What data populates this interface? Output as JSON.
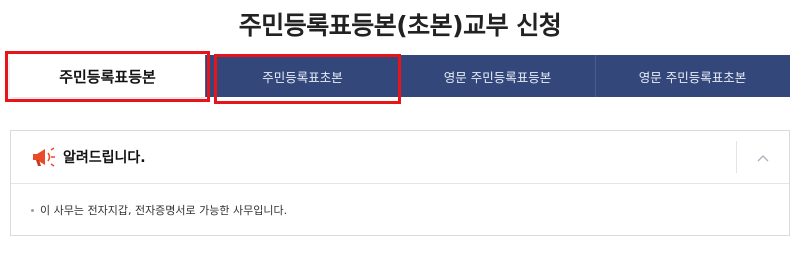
{
  "page": {
    "title": "주민등록표등본(초본)교부 신청"
  },
  "tabs": [
    {
      "label": "주민등록표등본",
      "active": true
    },
    {
      "label": "주민등록표초본",
      "active": false
    },
    {
      "label": "영문 주민등록표등본",
      "active": false
    },
    {
      "label": "영문 주민등록표초본",
      "active": false
    }
  ],
  "notice": {
    "icon": "megaphone-icon",
    "title": "알려드립니다.",
    "collapse_icon": "chevron-up-icon",
    "items": [
      "이 사무는 전자지갑, 전자증명서로 가능한 사무입니다."
    ]
  },
  "colors": {
    "tab_bg": "#34477a",
    "highlight": "#e8141c",
    "accent": "#e84a2a"
  }
}
